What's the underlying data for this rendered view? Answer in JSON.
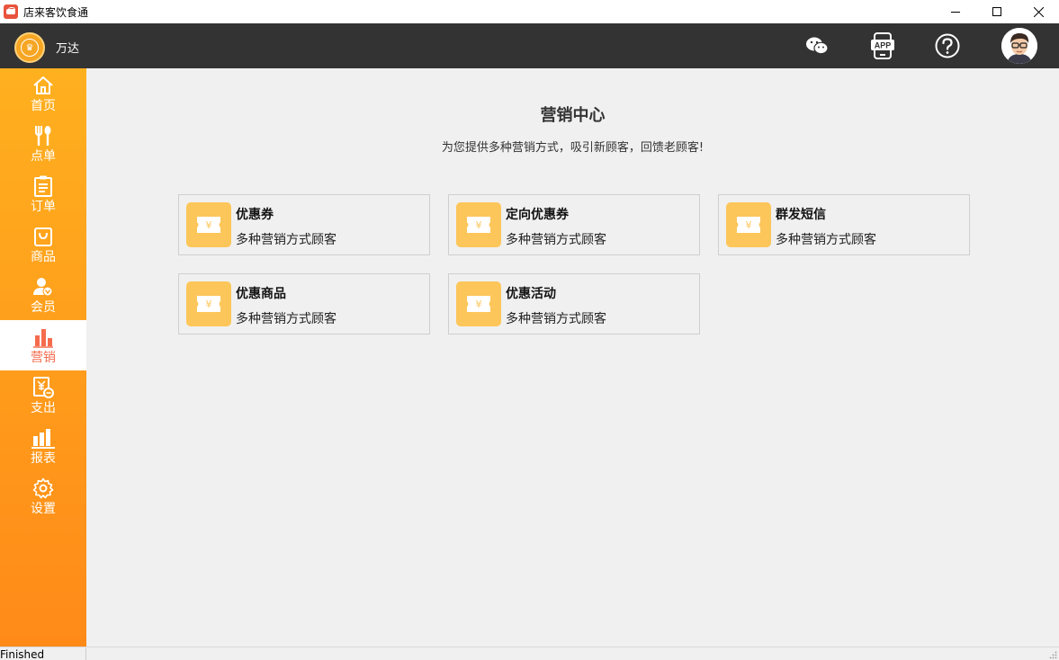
{
  "window": {
    "title": "店来客饮食通"
  },
  "header": {
    "store_name": "万达",
    "icons": [
      "wechat-icon",
      "app-download-icon",
      "help-icon",
      "user-avatar"
    ]
  },
  "sidebar": {
    "items": [
      {
        "label": "首页",
        "icon": "home-icon"
      },
      {
        "label": "点单",
        "icon": "fork-spoon-icon"
      },
      {
        "label": "订单",
        "icon": "clipboard-icon"
      },
      {
        "label": "商品",
        "icon": "shopping-bag-icon"
      },
      {
        "label": "会员",
        "icon": "member-icon"
      },
      {
        "label": "营销",
        "icon": "bar-chart-icon",
        "active": true
      },
      {
        "label": "支出",
        "icon": "expense-icon"
      },
      {
        "label": "报表",
        "icon": "report-icon"
      },
      {
        "label": "设置",
        "icon": "gear-icon"
      }
    ]
  },
  "main": {
    "title": "营销中心",
    "subtitle": "为您提供多种营销方式，吸引新顾客，回馈老顾客!",
    "cards": [
      {
        "title": "优惠券",
        "desc": "多种营销方式顾客"
      },
      {
        "title": "定向优惠券",
        "desc": "多种营销方式顾客"
      },
      {
        "title": "群发短信",
        "desc": "多种营销方式顾客"
      },
      {
        "title": "优惠商品",
        "desc": "多种营销方式顾客"
      },
      {
        "title": "优惠活动",
        "desc": "多种营销方式顾客"
      }
    ]
  },
  "statusbar": {
    "text": "Finished"
  },
  "colors": {
    "header_bg": "#333333",
    "sidebar_top": "#ffb01f",
    "sidebar_bottom": "#ff8a18",
    "active_text": "#f56b4e",
    "card_icon_bg": "#fdc65a"
  }
}
